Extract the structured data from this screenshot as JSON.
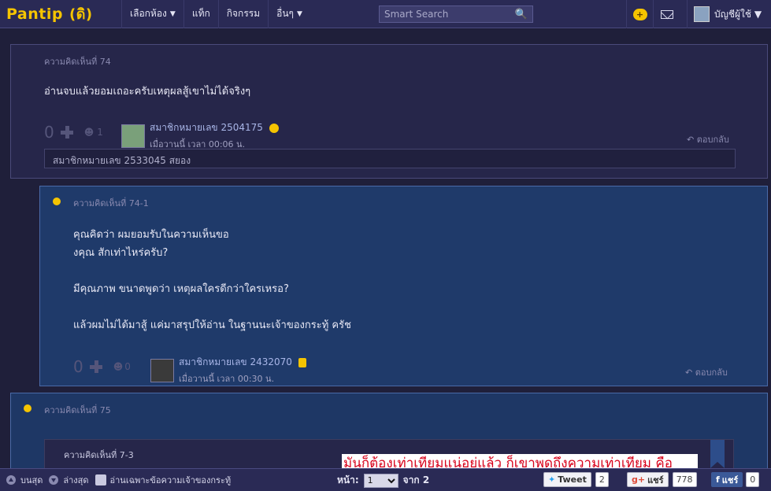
{
  "nav": {
    "logo": "Pantip",
    "logo_mark": "(ดิ)",
    "items": [
      {
        "label": "เลือกห้อง",
        "caret": "▼"
      },
      {
        "label": "แท็ก"
      },
      {
        "label": "กิจกรรม"
      },
      {
        "label": "อื่นๆ",
        "caret": "▼"
      }
    ],
    "search_placeholder": "Smart Search",
    "user_label": "บัญชีผู้ใช้ ▼",
    "icons": [
      "chat-icon",
      "mail-icon"
    ]
  },
  "comments": {
    "c74": {
      "title": "ความคิดเห็นที่ 74",
      "text": "อ่านจบแล้วยอมเถอะครับเหตุผลสู้เขาไม่ได้จริงๆ",
      "votes": "0",
      "emotions": "1",
      "member": "สมาชิกหมายเลข 2504175",
      "time": "เมื่อวานนี้ เวลา 00:06 น.",
      "reply": "ตอบกลับ",
      "quote": "สมาชิกหมายเลข 2533045 สยอง"
    },
    "c74_1": {
      "title": "ความคิดเห็นที่ 74-1",
      "text": "คุณคิดว่า ผมยอมรับในความเห็นขอ\nงคุณ สักเท่าไหร่ครับ?\n\nมีคุณภาพ ขนาดพูดว่า เหตุผลใครดีกว่าใครเหรอ?\n\nแล้วผมไม่ได้มาสู้ แค่มาสรุปให้อ่าน ในฐานนะเจ้าของกระทู้ ครัช",
      "votes": "0",
      "emotions": "0",
      "member": "สมาชิกหมายเลข 2432070",
      "time": "เมื่อวานนี้ เวลา 00:30 น.",
      "reply": "ตอบกลับ"
    },
    "c75": {
      "title": "ความคิดเห็นที่ 75",
      "quote_title": "ความคิดเห็นที่ 7-3"
    }
  },
  "banner_text": "มันก็ต้องเท่าเทียมแน่อยู่แล้ว ก็เขาพูดถึงความเท่าเทียม คือ",
  "bottom": {
    "top_label": "บนสุด",
    "bottom_label": "ล่างสุด",
    "owner_label": "อ่านเฉพาะข้อความเจ้าของกระทู้",
    "page_label": "หน้า:",
    "page_value": "1",
    "page_of": "จาก 2",
    "tweet_label": "Tweet",
    "tweet_count": "2",
    "gplus_label": "แชร์",
    "gplus_count": "778",
    "fb_label": "แชร์",
    "fb_count": "0"
  },
  "colors": {
    "background": "#1f1f3a",
    "topbar": "#2a2a55",
    "logo": "#f5c400",
    "banner_text": "#d8001a"
  }
}
